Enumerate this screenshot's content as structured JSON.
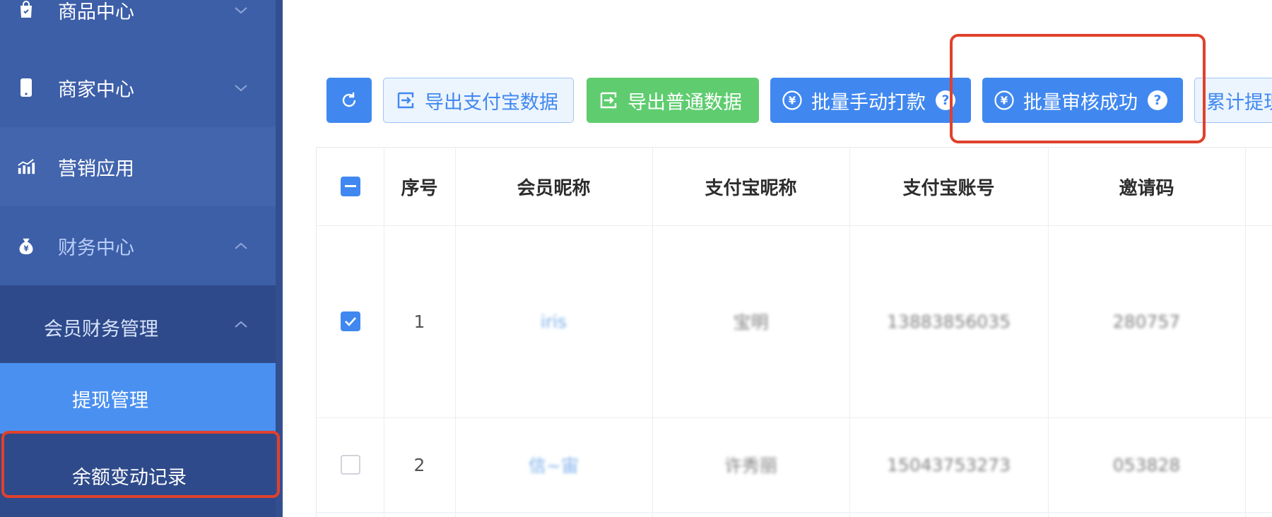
{
  "sidebar": {
    "items": [
      {
        "label": "商品中心"
      },
      {
        "label": "商家中心"
      },
      {
        "label": "营销应用"
      },
      {
        "label": "财务中心"
      }
    ],
    "group": {
      "label": "会员财务管理"
    },
    "leaves": [
      {
        "label": "提现管理"
      },
      {
        "label": "余额变动记录"
      }
    ],
    "colors": {
      "bg": "#3d5fa8",
      "selected": "#4a90f0",
      "highlight": "#e0412c"
    }
  },
  "toolbar": {
    "refresh_icon": "refresh-icon",
    "export_alipay_label": "导出支付宝数据",
    "export_normal_label": "导出普通数据",
    "batch_manual_pay_label": "批量手动打款",
    "batch_approve_label": "批量审核成功",
    "cumulative_label": "累计提现",
    "help_glyph": "?"
  },
  "table": {
    "headers": [
      "序号",
      "会员昵称",
      "支付宝昵称",
      "支付宝账号",
      "邀请码"
    ],
    "rows": [
      {
        "index": "1",
        "nickname": "iris",
        "alipay_nick": "宝明",
        "alipay_account": "13883856035",
        "invite": "280757",
        "checked": true
      },
      {
        "index": "2",
        "nickname": "信~宙",
        "alipay_nick": "许秀丽",
        "alipay_account": "15043753273",
        "invite": "053828",
        "checked": false
      }
    ]
  }
}
